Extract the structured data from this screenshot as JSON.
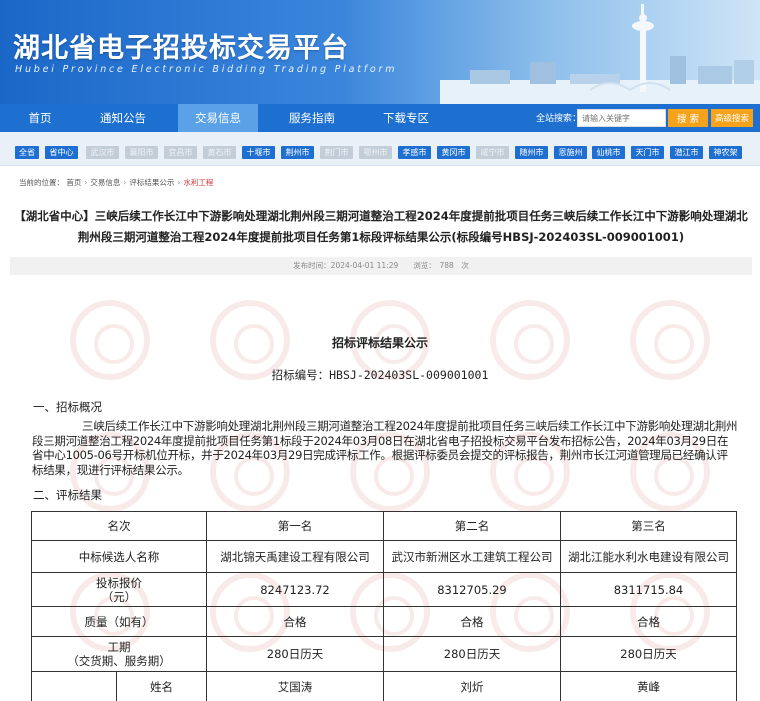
{
  "header": {
    "title": "湖北省电子招投标交易平台",
    "subtitle": "Hubei Province Electronic Bidding Trading Platform"
  },
  "nav": {
    "items": [
      "首页",
      "通知公告",
      "交易信息",
      "服务指南",
      "下载专区"
    ],
    "active_index": 2,
    "search_label": "全站搜索：",
    "search_placeholder": "请输入关键字",
    "search_button": "搜 索",
    "advanced_button": "高级搜索"
  },
  "cities": [
    {
      "name": "全省",
      "enabled": true
    },
    {
      "name": "省中心",
      "enabled": true
    },
    {
      "name": "武汉市",
      "enabled": false
    },
    {
      "name": "襄阳市",
      "enabled": false
    },
    {
      "name": "宜昌市",
      "enabled": false
    },
    {
      "name": "黄石市",
      "enabled": false
    },
    {
      "name": "十堰市",
      "enabled": true
    },
    {
      "name": "荆州市",
      "enabled": true
    },
    {
      "name": "荆门市",
      "enabled": false
    },
    {
      "name": "鄂州市",
      "enabled": false
    },
    {
      "name": "孝感市",
      "enabled": true
    },
    {
      "name": "黄冈市",
      "enabled": true
    },
    {
      "name": "咸宁市",
      "enabled": false
    },
    {
      "name": "随州市",
      "enabled": true
    },
    {
      "name": "恩施州",
      "enabled": true
    },
    {
      "name": "仙桃市",
      "enabled": true
    },
    {
      "name": "天门市",
      "enabled": true
    },
    {
      "name": "潜江市",
      "enabled": true
    },
    {
      "name": "神农架",
      "enabled": true
    }
  ],
  "breadcrumb": {
    "prefix": "当前的位置：",
    "items": [
      "首页",
      "交易信息",
      "评标结果公示"
    ],
    "current": "水利工程",
    "separator": "›"
  },
  "article": {
    "title": "【湖北省中心】三峡后续工作长江中下游影响处理湖北荆州段三期河道整治工程2024年度提前批项目任务三峡后续工作长江中下游影响处理湖北荆州段三期河道整治工程2024年度提前批项目任务第1标段评标结果公示(标段编号HBSJ-202403SL-009001001)",
    "meta": "发布时间：2024-04-01 11:29　　浏览：　788　次"
  },
  "doc": {
    "title": "招标评标结果公示",
    "code": "招标编号：HBSJ-202403SL-009001001",
    "section1": "一、招标概况",
    "paragraph": "三峡后续工作长江中下游影响处理湖北荆州段三期河道整治工程2024年度提前批项目任务三峡后续工作长江中下游影响处理湖北荆州段三期河道整治工程2024年度提前批项目任务第1标段于2024年03月08日在湖北省电子招投标交易平台发布招标公告，2024年03月29日在省中心1005-06号开标机位开标，并于2024年03月29日完成评标工作。根据评标委员会提交的评标报告，荆州市长江河道管理局已经确认评标结果，现进行评标结果公示。",
    "section2": "二、评标结果"
  },
  "table": {
    "header": [
      "名次",
      "第一名",
      "第二名",
      "第三名"
    ],
    "rows": [
      {
        "label": "中标候选人名称",
        "values": [
          "湖北锦天禹建设工程有限公司",
          "武汉市新洲区水工建筑工程公司",
          "湖北江能水利水电建设有限公司"
        ]
      },
      {
        "label": "投标报价\n（元）",
        "values": [
          "8247123.72",
          "8312705.29",
          "8311715.84"
        ]
      },
      {
        "label": "质量（如有）",
        "values": [
          "合格",
          "合格",
          "合格"
        ]
      },
      {
        "label": "工期\n（交货期、服务期）",
        "values": [
          "280日历天",
          "280日历天",
          "280日历天"
        ]
      }
    ],
    "sub_row": {
      "label": "姓名",
      "values": [
        "艾国涛",
        "刘炘",
        "黄峰"
      ]
    }
  },
  "colors": {
    "nav_bg": "#1d6fd0",
    "nav_active": "#5aa1e8",
    "search_button": "#f6a21b",
    "city_enabled": "#1e6fd1",
    "city_disabled": "#c3cdd8",
    "breadcrumb_current": "#d33333"
  }
}
